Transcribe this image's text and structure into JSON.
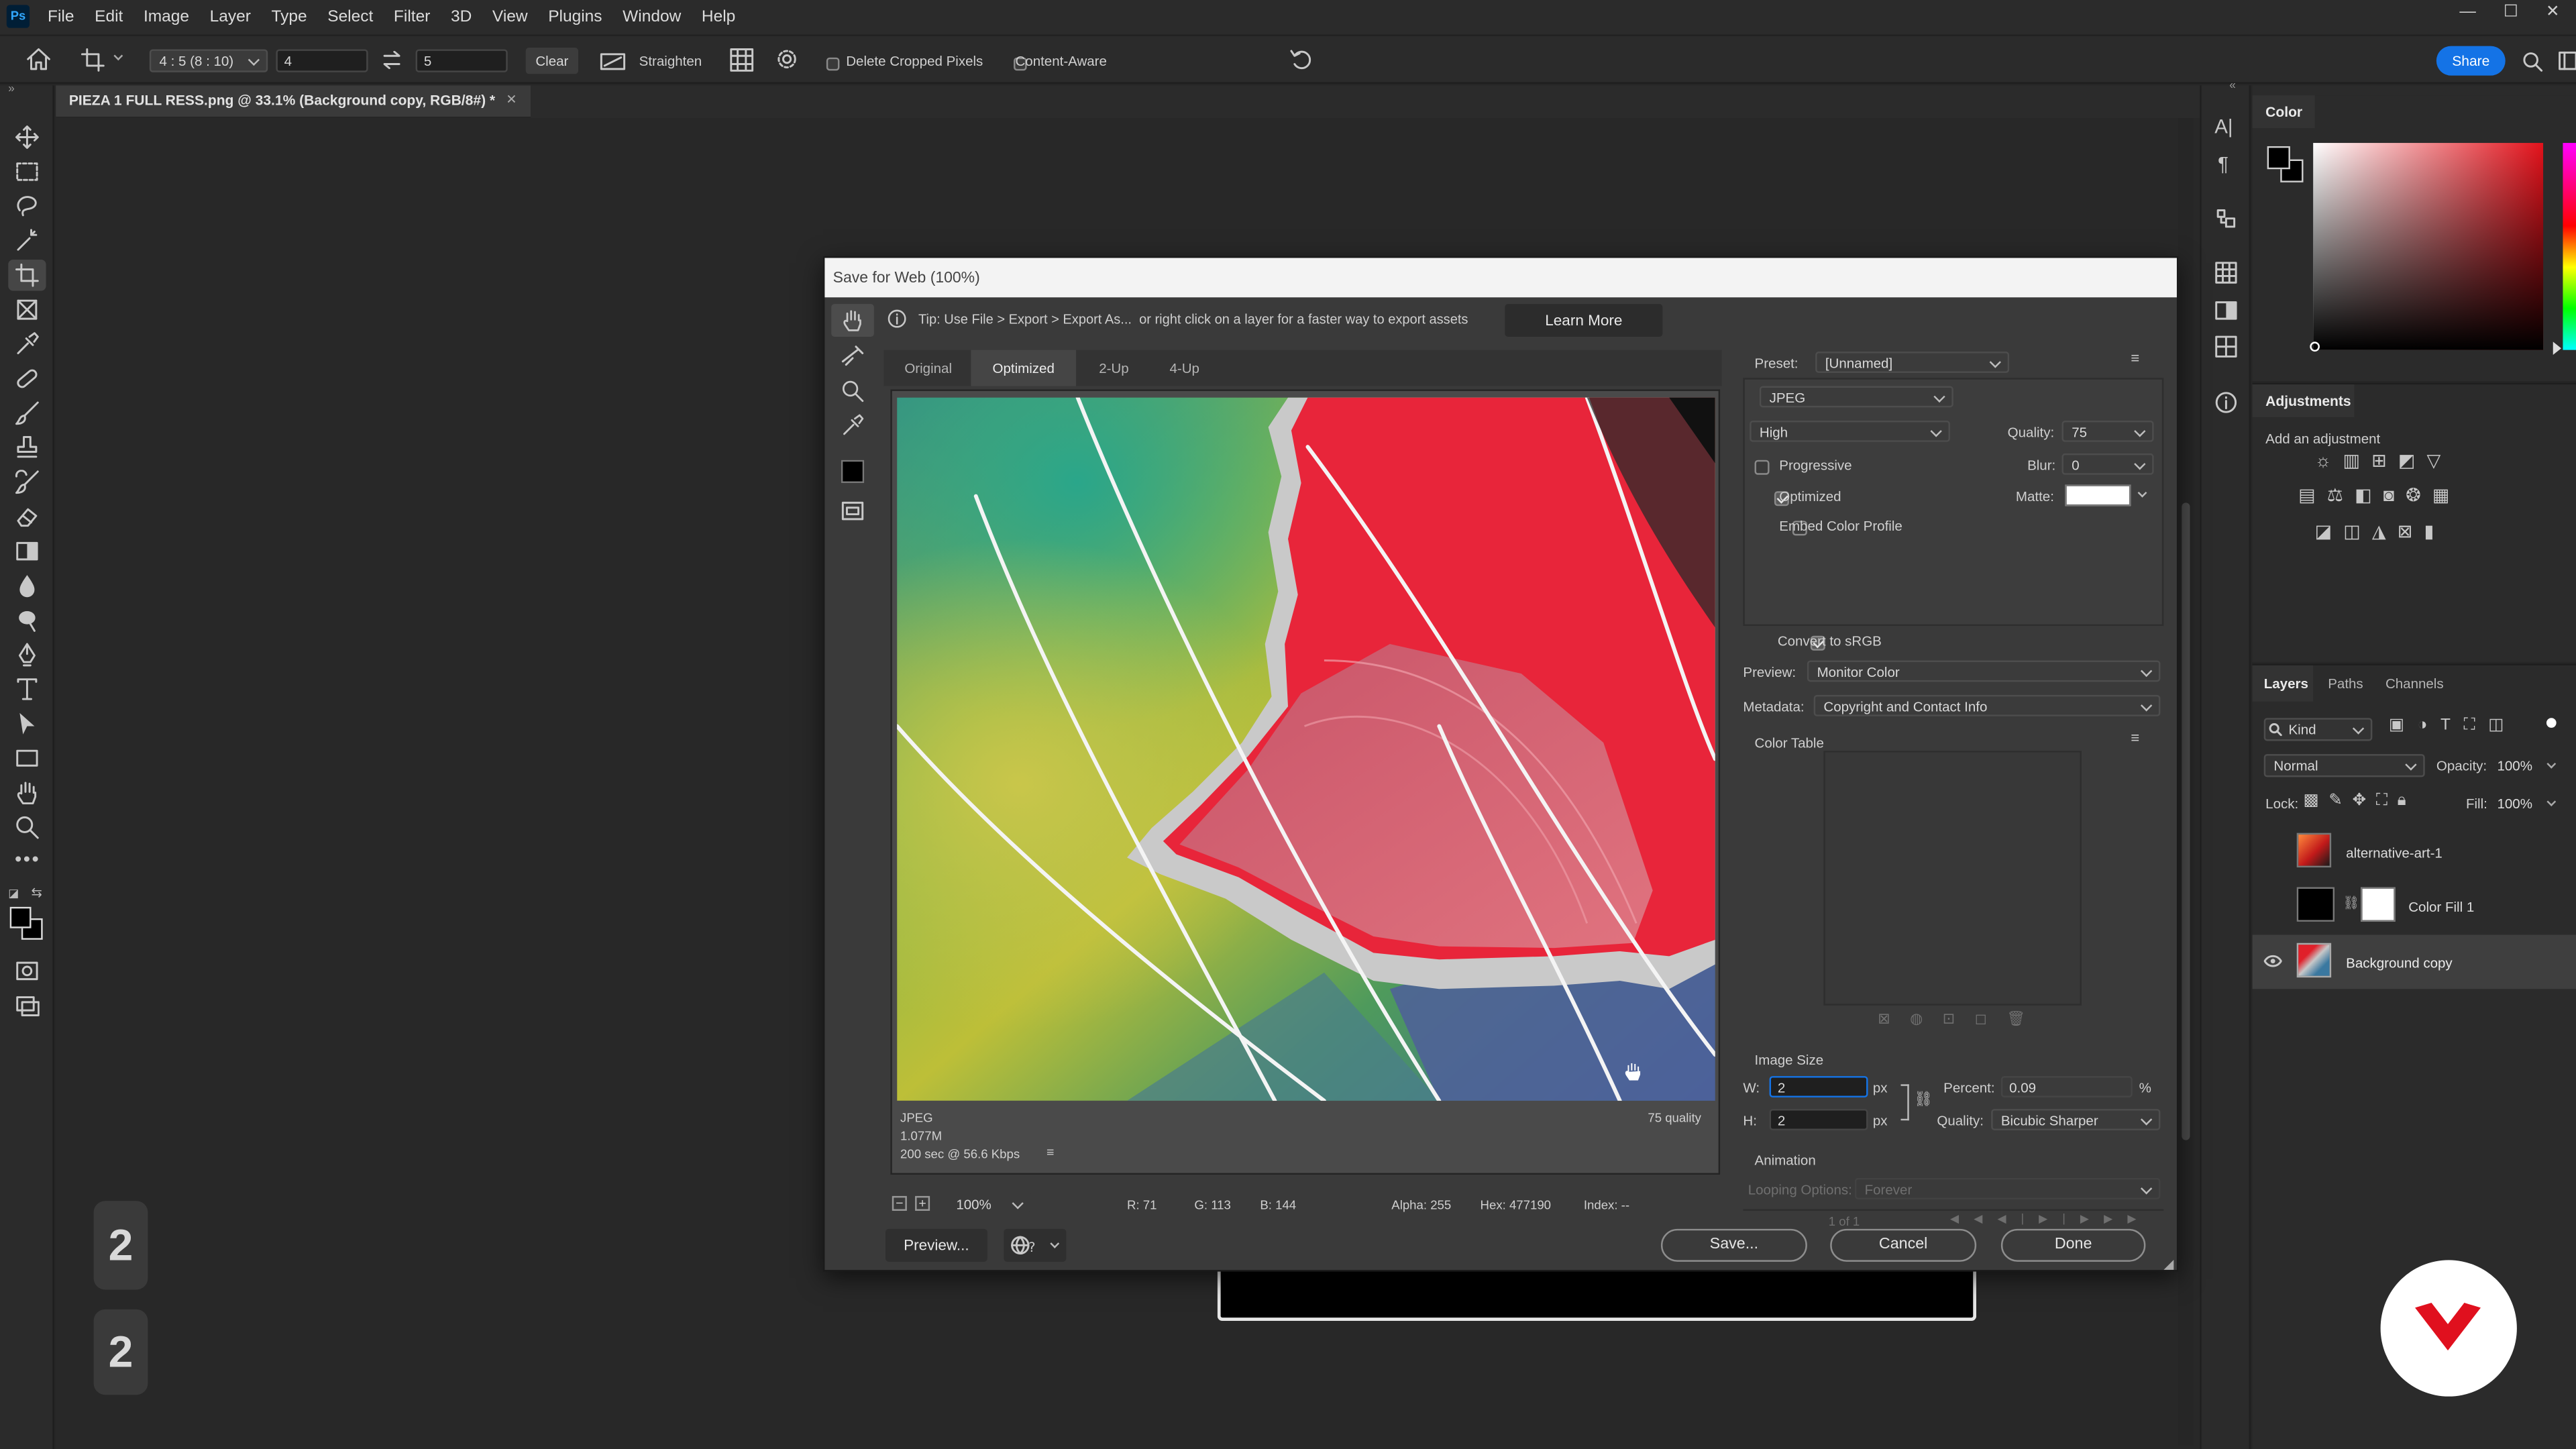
{
  "app": {
    "logo": "Ps",
    "menu": [
      "File",
      "Edit",
      "Image",
      "Layer",
      "Type",
      "Select",
      "Filter",
      "3D",
      "View",
      "Plugins",
      "Window",
      "Help"
    ],
    "share_label": "Share"
  },
  "options_bar": {
    "ratio": "4 : 5 (8 : 10)",
    "width_value": "4",
    "height_value": "5",
    "clear_label": "Clear",
    "straighten_label": "Straighten",
    "delete_cropped_label": "Delete Cropped Pixels",
    "content_aware_label": "Content-Aware"
  },
  "document_tab": {
    "title": "PIEZA 1 FULL RESS.png @ 33.1% (Background copy, RGB/8#) *"
  },
  "dialog": {
    "title": "Save for Web (100%)",
    "tip": "Tip: Use File > Export > Export As...  or right click on a layer for a faster way to export assets",
    "learn_more": "Learn More",
    "tabs": [
      "Original",
      "Optimized",
      "2-Up",
      "4-Up"
    ],
    "active_tab": "Optimized",
    "preview_info": {
      "format": "JPEG",
      "size": "1.077M",
      "time": "200 sec @ 56.6 Kbps",
      "quality_note": "75 quality"
    },
    "status_bar": {
      "zoom": "100%",
      "r": "R: 71",
      "g": "G: 113",
      "b": "B: 144",
      "alpha": "Alpha: 255",
      "hex": "Hex: 477190",
      "index": "Index: --"
    },
    "preview_button": "Preview...",
    "save_button": "Save...",
    "cancel_button": "Cancel",
    "done_button": "Done",
    "settings": {
      "preset_label": "Preset:",
      "preset_value": "[Unnamed]",
      "format_value": "JPEG",
      "quality_level": "High",
      "quality_label": "Quality:",
      "quality_value": "75",
      "blur_label": "Blur:",
      "blur_value": "0",
      "matte_label": "Matte:",
      "progressive_label": "Progressive",
      "progressive_checked": false,
      "optimized_label": "Optimized",
      "optimized_checked": true,
      "embed_label": "Embed Color Profile",
      "embed_checked": false,
      "convert_label": "Convert to sRGB",
      "convert_checked": true,
      "preview_label": "Preview:",
      "preview_value": "Monitor Color",
      "metadata_label": "Metadata:",
      "metadata_value": "Copyright and Contact Info",
      "color_table_label": "Color Table",
      "image_size_label": "Image Size",
      "w_label": "W:",
      "w_value": "2",
      "h_label": "H:",
      "h_value": "2",
      "px": "px",
      "percent_label": "Percent:",
      "percent_value": "0.09",
      "percent_unit": "%",
      "resample_label": "Quality:",
      "resample_value": "Bicubic Sharper",
      "animation_label": "Animation",
      "looping_label": "Looping Options:",
      "looping_value": "Forever",
      "frame_counter": "1 of 1"
    }
  },
  "panels": {
    "color_tab": "Color",
    "adjustments_tab": "Adjustments",
    "add_adjustment": "Add an adjustment",
    "layers_tabs": [
      "Layers",
      "Paths",
      "Channels"
    ],
    "kind_filter": "Kind",
    "blend_mode": "Normal",
    "opacity_label": "Opacity:",
    "opacity_value": "100%",
    "lock_label": "Lock:",
    "fill_label": "Fill:",
    "fill_value": "100%",
    "layers": [
      {
        "name": "alternative-art-1",
        "visible": false
      },
      {
        "name": "Color Fill 1",
        "visible": false
      },
      {
        "name": "Background copy",
        "visible": true
      }
    ]
  },
  "canvas_badges": [
    "2",
    "2"
  ],
  "colors": {
    "accent": "#1473e6",
    "brand_red": "#e0101e",
    "matte": "#ffffff"
  }
}
